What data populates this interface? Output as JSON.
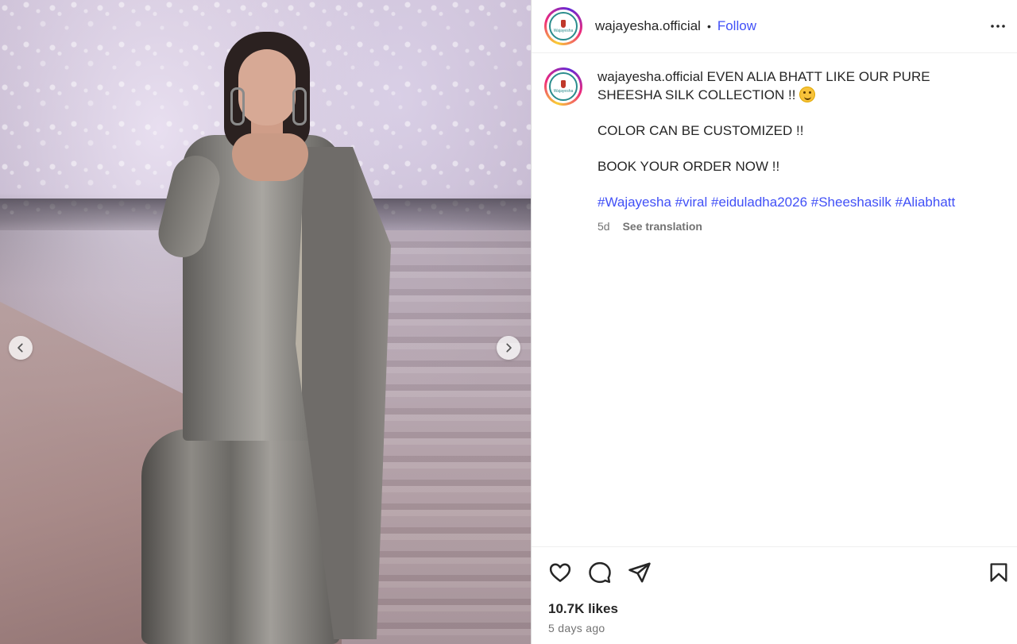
{
  "post": {
    "username": "wajayesha.official",
    "separator": "•",
    "follow_label": "Follow",
    "avatar_brand": "Wajayesha",
    "caption": {
      "line1": "EVEN ALIA BHATT LIKE OUR PURE SHEESHA SILK COLLECTION !!",
      "line2": "COLOR CAN BE CUSTOMIZED !!",
      "line3": "BOOK YOUR ORDER NOW !!",
      "hashtags": [
        "#Wajayesha",
        "#viral",
        "#eiduladha2026",
        "#Sheeshasilk",
        "#Aliabhatt"
      ]
    },
    "age_short": "5d",
    "see_translation": "See translation",
    "likes": "10.7K likes",
    "age_long": "5 days ago"
  },
  "icons": {
    "more": "more-options-icon",
    "like": "heart-icon",
    "comment": "comment-icon",
    "share": "share-icon",
    "save": "bookmark-icon",
    "prev": "chevron-left-icon",
    "next": "chevron-right-icon"
  },
  "colors": {
    "link": "#4150f7",
    "text": "#262626",
    "muted": "#737373"
  }
}
